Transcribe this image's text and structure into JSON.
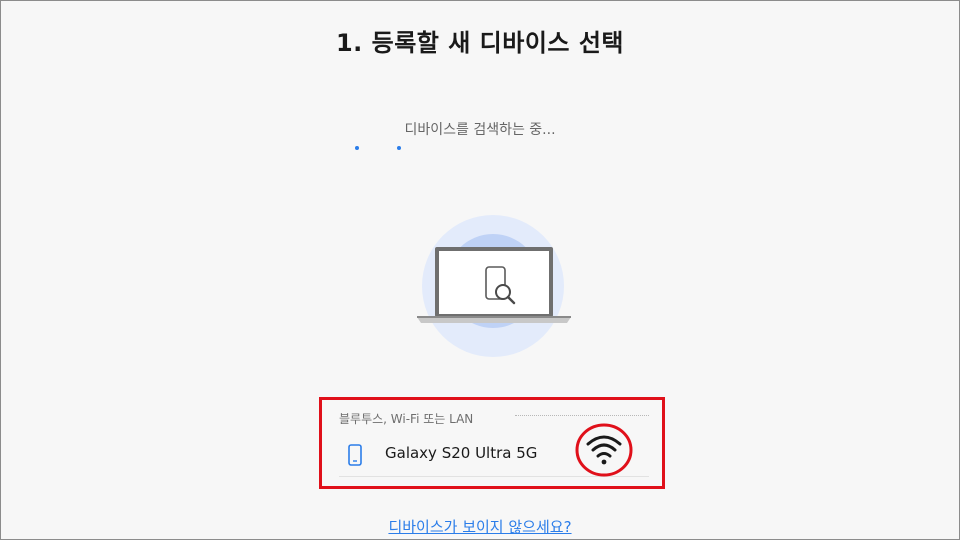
{
  "header": {
    "title": "1. 등록할 새 디바이스 선택"
  },
  "search": {
    "status_text": "디바이스를 검색하는 중..."
  },
  "device_group": {
    "label": "블루투스, Wi-Fi 또는 LAN",
    "devices": [
      {
        "name": "Galaxy S20 Ultra 5G",
        "icon": "phone-icon",
        "connection_icon": "wifi-icon"
      }
    ]
  },
  "footer": {
    "help_link": "디바이스가 보이지 않으세요?"
  },
  "colors": {
    "accent": "#2b7de9",
    "highlight_box": "#e0101a",
    "background": "#f7f7f7"
  }
}
